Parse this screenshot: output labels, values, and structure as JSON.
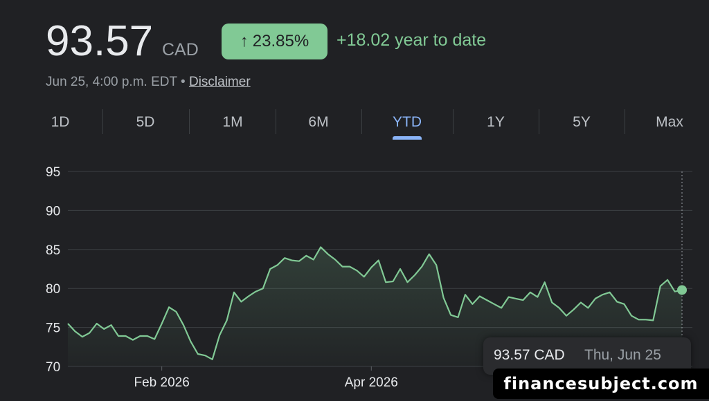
{
  "quote": {
    "price": "93.57",
    "currency": "CAD",
    "change_arrow": "↑",
    "change_percent": "23.85%",
    "change_text": "+18.02 year to date",
    "timestamp": "Jun 25, 4:00 p.m. EDT",
    "separator": "•",
    "disclaimer_label": "Disclaimer"
  },
  "tabs": [
    {
      "label": "1D",
      "active": false
    },
    {
      "label": "5D",
      "active": false
    },
    {
      "label": "1M",
      "active": false
    },
    {
      "label": "6M",
      "active": false
    },
    {
      "label": "YTD",
      "active": true
    },
    {
      "label": "1Y",
      "active": false
    },
    {
      "label": "5Y",
      "active": false
    },
    {
      "label": "Max",
      "active": false
    }
  ],
  "tooltip": {
    "value": "93.57 CAD",
    "date": "Thu, Jun 25"
  },
  "watermark": "financesubject.com",
  "colors": {
    "background": "#202124",
    "positive": "#81c995",
    "active_tab": "#8ab4f8",
    "grid": "#3c4043"
  },
  "chart_data": {
    "type": "area",
    "y_ticks": [
      95,
      90,
      85,
      80,
      75,
      70
    ],
    "ylim": [
      70,
      95.5
    ],
    "x_tick_labels": [
      {
        "label": "Feb 2026",
        "x": 26
      },
      {
        "label": "Apr 2026",
        "x": 84
      }
    ],
    "xlim": [
      0,
      170
    ],
    "grid": true,
    "series": [
      {
        "values": [
          [
            0,
            75.5
          ],
          [
            2,
            74.5
          ],
          [
            4,
            73.8
          ],
          [
            6,
            74.3
          ],
          [
            8,
            75.5
          ],
          [
            10,
            74.8
          ],
          [
            12,
            75.3
          ],
          [
            14,
            73.9
          ],
          [
            16,
            73.9
          ],
          [
            18,
            73.4
          ],
          [
            20,
            73.9
          ],
          [
            22,
            73.9
          ],
          [
            24,
            73.5
          ],
          [
            26,
            75.5
          ],
          [
            28,
            77.6
          ],
          [
            30,
            77.0
          ],
          [
            32,
            75.3
          ],
          [
            34,
            73.2
          ],
          [
            36,
            71.6
          ],
          [
            38,
            71.4
          ],
          [
            40,
            70.9
          ],
          [
            42,
            74.0
          ],
          [
            44,
            75.9
          ],
          [
            46,
            79.5
          ],
          [
            48,
            78.3
          ],
          [
            50,
            79.0
          ],
          [
            52,
            79.6
          ],
          [
            54,
            80.0
          ],
          [
            56,
            82.5
          ],
          [
            58,
            83.0
          ],
          [
            60,
            83.9
          ],
          [
            62,
            83.6
          ],
          [
            64,
            83.5
          ],
          [
            66,
            84.2
          ],
          [
            68,
            83.7
          ],
          [
            70,
            85.3
          ],
          [
            72,
            84.4
          ],
          [
            74,
            83.7
          ],
          [
            76,
            82.8
          ],
          [
            78,
            82.8
          ],
          [
            80,
            82.3
          ],
          [
            82,
            81.5
          ],
          [
            84,
            82.7
          ],
          [
            86,
            83.6
          ],
          [
            88,
            80.8
          ],
          [
            90,
            80.9
          ],
          [
            92,
            82.5
          ],
          [
            94,
            80.8
          ],
          [
            96,
            81.7
          ],
          [
            98,
            82.8
          ],
          [
            100,
            84.4
          ],
          [
            102,
            83.0
          ],
          [
            104,
            78.8
          ],
          [
            106,
            76.6
          ],
          [
            108,
            76.3
          ],
          [
            110,
            79.2
          ],
          [
            112,
            78.0
          ],
          [
            114,
            79.0
          ],
          [
            116,
            78.5
          ],
          [
            118,
            78.0
          ],
          [
            120,
            77.5
          ],
          [
            122,
            78.9
          ],
          [
            124,
            78.7
          ],
          [
            126,
            78.5
          ],
          [
            128,
            79.5
          ],
          [
            130,
            78.9
          ],
          [
            132,
            80.8
          ],
          [
            134,
            78.2
          ],
          [
            136,
            77.5
          ],
          [
            138,
            76.5
          ],
          [
            140,
            77.3
          ],
          [
            142,
            78.2
          ],
          [
            144,
            77.5
          ],
          [
            146,
            78.7
          ],
          [
            148,
            79.2
          ],
          [
            150,
            79.5
          ],
          [
            152,
            78.3
          ],
          [
            154,
            78.0
          ],
          [
            156,
            76.5
          ],
          [
            158,
            76.0
          ],
          [
            160,
            76.0
          ],
          [
            162,
            75.9
          ],
          [
            164,
            80.3
          ],
          [
            166,
            81.1
          ],
          [
            168,
            79.6
          ],
          [
            170,
            79.8
          ]
        ]
      }
    ]
  }
}
